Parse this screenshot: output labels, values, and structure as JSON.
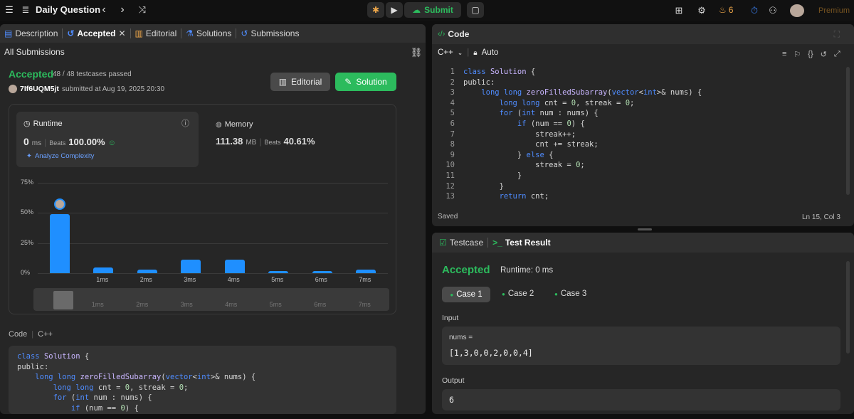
{
  "topbar": {
    "title": "Daily Question",
    "submit_label": "Submit",
    "streak_count": "6",
    "premium_label": "Premium"
  },
  "left": {
    "tabs": [
      {
        "label": "Description"
      },
      {
        "label": "Accepted"
      },
      {
        "label": "Editorial"
      },
      {
        "label": "Solutions"
      },
      {
        "label": "Submissions"
      }
    ],
    "all_submissions": "All Submissions",
    "status": "Accepted",
    "testcases": "48 / 48 testcases passed",
    "user": "7If6UQM5jt",
    "submitted_at": "submitted at Aug 19, 2025 20:30",
    "editorial_btn": "Editorial",
    "solution_btn": "Solution",
    "runtime": {
      "label": "Runtime",
      "value": "0",
      "unit": "ms",
      "beats_label": "Beats",
      "beats": "100.00%",
      "analyze": "Analyze Complexity"
    },
    "memory": {
      "label": "Memory",
      "value": "111.38",
      "unit": "MB",
      "beats_label": "Beats",
      "beats": "40.61%"
    },
    "code_label": "Code",
    "lang": "C++",
    "code_lines": [
      "class Solution {",
      "public:",
      "    long long zeroFilledSubarray(vector<int>& nums) {",
      "        long long cnt = 0, streak = 0;",
      "        for (int num : nums) {",
      "            if (num == 0) {"
    ]
  },
  "chart_data": {
    "type": "bar",
    "yticks": [
      "75%",
      "50%",
      "25%",
      "0%"
    ],
    "ylim": [
      0,
      75
    ],
    "categories": [
      "0ms",
      "1ms",
      "2ms",
      "3ms",
      "4ms",
      "5ms",
      "6ms",
      "7ms"
    ],
    "xticks": [
      "1ms",
      "2ms",
      "3ms",
      "4ms",
      "5ms",
      "6ms",
      "7ms"
    ],
    "values": [
      49,
      5,
      3,
      11,
      11,
      2,
      2,
      3
    ]
  },
  "editor": {
    "title": "Code",
    "lang": "C++",
    "auto": "Auto",
    "saved": "Saved",
    "cursor": "Ln 15, Col 3",
    "line_numbers": [
      "1",
      "2",
      "3",
      "4",
      "5",
      "6",
      "7",
      "8",
      "9",
      "10",
      "11",
      "12",
      "13"
    ]
  },
  "result": {
    "testcase_tab": "Testcase",
    "result_tab": "Test Result",
    "status": "Accepted",
    "runtime": "Runtime: 0 ms",
    "cases": [
      "Case 1",
      "Case 2",
      "Case 3"
    ],
    "input_label": "Input",
    "input_name": "nums =",
    "input_value": "[1,3,0,0,2,0,0,4]",
    "output_label": "Output",
    "output_value": "6"
  },
  "colors": {
    "accent_green": "#2cbb5d",
    "bar_blue": "#1f8fff",
    "background": "#0f0f0f"
  }
}
